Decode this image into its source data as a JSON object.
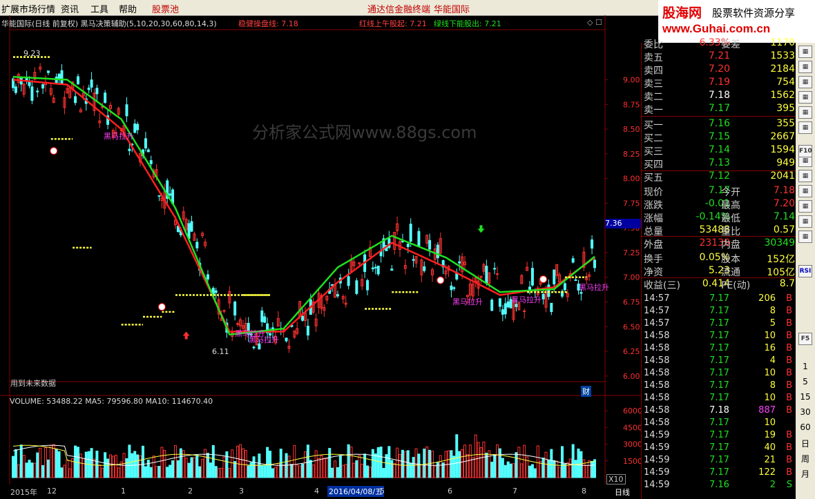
{
  "menu": {
    "items": [
      "扩展市场行情",
      "资讯",
      "工具",
      "帮助"
    ],
    "stock_pool": "股票池",
    "terminal": "通达信金融终端",
    "stock_name": "华能国际"
  },
  "logo": {
    "name": "股海网",
    "tagline": "股票软件资源分享",
    "url": "www.Guhai.com.cn"
  },
  "chart": {
    "title": "华能国际(日线 前复权) 黑马决策辅助(5,10,20,30,60,80,14,3)",
    "steady": "稳健操盘线: 7.18",
    "red_line": "红线上午股起: 7.21",
    "green_line": "绿线下能股出: 7.21",
    "watermark": "分析家公式网www.88gs.com",
    "future_note": "用到未来数据",
    "high_label": "9.23",
    "low_label": "6.11",
    "current_price_tag": "7.36",
    "signal_labels": [
      "黑马拉升",
      "黑马拉升",
      "黑马拉升",
      "黑马拉升",
      "黑马拉升",
      "黑马拉升"
    ],
    "volume_header": "VOLUME: 53488.22  MA5: 79596.80  MA10: 114670.40",
    "volume_scale": "X10",
    "period": "日线",
    "caiwu": "财",
    "date_badge": "2016/04/08/五",
    "x_labels": [
      "2015年",
      "12",
      "1",
      "2",
      "3",
      "4",
      "5",
      "6",
      "7",
      "8"
    ],
    "colors": {
      "up": "#ff3232",
      "down": "#54ffff",
      "ma_red": "#ff2020",
      "ma_green": "#20e020",
      "dotted": "#ffff40",
      "signal": "#ff40ff"
    }
  },
  "chart_data": {
    "type": "line",
    "title": "华能国际(日线 前复权)",
    "ylim": [
      5.95,
      9.5
    ],
    "y_ticks": [
      9.0,
      8.75,
      8.5,
      8.25,
      8.0,
      7.75,
      7.5,
      7.25,
      7.0,
      6.75,
      6.5,
      6.25,
      6.0
    ],
    "volume_ticks": [
      60000,
      45000,
      30000,
      15000
    ],
    "x": [
      0,
      20,
      40,
      60,
      80,
      100,
      120,
      140,
      160,
      180,
      200,
      215
    ],
    "series": [
      {
        "name": "红线",
        "values": [
          9.0,
          8.95,
          8.5,
          7.6,
          6.45,
          6.45,
          6.95,
          7.35,
          7.1,
          6.82,
          6.9,
          7.2
        ]
      },
      {
        "name": "绿线",
        "values": [
          9.03,
          9.0,
          8.6,
          7.7,
          6.42,
          6.48,
          7.1,
          7.42,
          7.2,
          6.85,
          6.88,
          7.21
        ]
      }
    ]
  },
  "quote": {
    "top_row": {
      "label": "委比",
      "value": "6.33%",
      "label2": "委差",
      "value2": "1170"
    },
    "asks": [
      {
        "label": "卖五",
        "price": "7.21",
        "vol": "1533"
      },
      {
        "label": "卖四",
        "price": "7.20",
        "vol": "2184"
      },
      {
        "label": "卖三",
        "price": "7.19",
        "vol": "754"
      },
      {
        "label": "卖二",
        "price": "7.18",
        "vol": "1562"
      },
      {
        "label": "卖一",
        "price": "7.17",
        "vol": "395"
      }
    ],
    "bids": [
      {
        "label": "买一",
        "price": "7.16",
        "vol": "355"
      },
      {
        "label": "买二",
        "price": "7.15",
        "vol": "2667"
      },
      {
        "label": "买三",
        "price": "7.14",
        "vol": "1594"
      },
      {
        "label": "买四",
        "price": "7.13",
        "vol": "949"
      },
      {
        "label": "买五",
        "price": "7.12",
        "vol": "2041"
      }
    ],
    "stats": [
      {
        "l": "现价",
        "v": "7.17",
        "l2": "今开",
        "v2": "7.18"
      },
      {
        "l": "涨跌",
        "v": "-0.01",
        "l2": "最高",
        "v2": "7.20"
      },
      {
        "l": "涨幅",
        "v": "-0.14%",
        "l2": "最低",
        "v2": "7.14"
      },
      {
        "l": "总量",
        "v": "53488",
        "l2": "量比",
        "v2": "0.57"
      },
      {
        "l": "外盘",
        "v": "23139",
        "l2": "内盘",
        "v2": "30349"
      }
    ],
    "stats2": [
      {
        "l": "换手",
        "v": "0.05%",
        "l2": "股本",
        "v2": "152亿"
      },
      {
        "l": "净资",
        "v": "5.23",
        "l2": "流通",
        "v2": "105亿"
      },
      {
        "l": "收益(三)",
        "v": "0.414",
        "l2": "PE(动)",
        "v2": "8.7"
      }
    ],
    "ticks": [
      {
        "t": "14:57",
        "p": "7.17",
        "v": "206",
        "s": "B"
      },
      {
        "t": "14:57",
        "p": "7.17",
        "v": "8",
        "s": "B"
      },
      {
        "t": "14:57",
        "p": "7.17",
        "v": "5",
        "s": "B"
      },
      {
        "t": "14:58",
        "p": "7.17",
        "v": "10",
        "s": "B"
      },
      {
        "t": "14:58",
        "p": "7.17",
        "v": "16",
        "s": "B"
      },
      {
        "t": "14:58",
        "p": "7.17",
        "v": "4",
        "s": "B"
      },
      {
        "t": "14:58",
        "p": "7.17",
        "v": "10",
        "s": "B"
      },
      {
        "t": "14:58",
        "p": "7.17",
        "v": "8",
        "s": "B"
      },
      {
        "t": "14:58",
        "p": "7.17",
        "v": "10",
        "s": "B"
      },
      {
        "t": "14:58",
        "p": "7.18",
        "v": "887",
        "s": "B"
      },
      {
        "t": "14:58",
        "p": "7.17",
        "v": "10",
        "s": ""
      },
      {
        "t": "14:59",
        "p": "7.17",
        "v": "19",
        "s": "B"
      },
      {
        "t": "14:59",
        "p": "7.17",
        "v": "40",
        "s": "B"
      },
      {
        "t": "14:59",
        "p": "7.17",
        "v": "21",
        "B": "",
        "s": "B"
      },
      {
        "t": "14:59",
        "p": "7.17",
        "v": "122",
        "s": "B"
      },
      {
        "t": "14:59",
        "p": "7.16",
        "v": "2",
        "s": "S"
      }
    ]
  },
  "toolbar": {
    "labels": [
      "1",
      "5",
      "15",
      "30",
      "60",
      "日",
      "周",
      "月"
    ],
    "f10": "F10",
    "f5": "F5",
    "rsi": "RSI"
  }
}
